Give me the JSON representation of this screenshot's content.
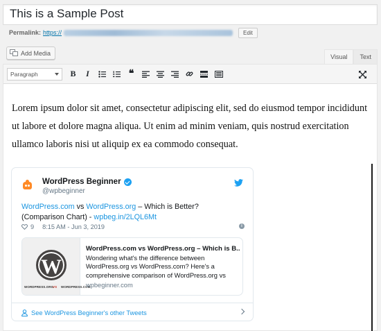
{
  "post": {
    "title": "This is a Sample Post",
    "permalink_label": "Permalink:",
    "permalink_url": "https://",
    "edit_label": "Edit"
  },
  "editor": {
    "add_media_label": "Add Media",
    "tabs": {
      "visual": "Visual",
      "text": "Text"
    },
    "toolbar": {
      "format_value": "Paragraph",
      "buttons": [
        "bold",
        "italic",
        "bulleted-list",
        "numbered-list",
        "blockquote",
        "align-left",
        "align-center",
        "align-right",
        "insert-link",
        "read-more",
        "toolbar-toggle",
        "distraction-free"
      ]
    },
    "content": {
      "paragraph": "Lorem ipsum dolor sit amet, consectetur adipiscing elit, sed do eiusmod tempor incididunt ut labore et dolore magna aliqua. Ut enim ad minim veniam, quis nostrud exercitation ullamco laboris nisi ut aliquip ex ea commodo consequat."
    }
  },
  "tweet": {
    "name": "WordPress Beginner",
    "handle": "@wpbeginner",
    "text_link1": "WordPress.com",
    "text_vs": " vs ",
    "text_link2": "WordPress.org",
    "text_rest": " – Which is Better? (Comparison Chart) - ",
    "text_link3": "wpbeg.in/2LQL6Mt",
    "likes": "9",
    "timestamp": "8:15 AM - Jun 3, 2019",
    "card": {
      "title": "WordPress.com vs WordPress.org – Which is B...",
      "description": "Wondering what's the difference between WordPress.org vs WordPress.com? Here's a comprehensive comparison of WordPress.org vs",
      "url": "wpbeginner.com",
      "img_label_left": "WORDPRESS.ORG",
      "img_label_vs": "VS",
      "img_label_right": "WORDPRESS.COM",
      "logo_letter": "W"
    },
    "footer_link": "See WordPress Beginner's other Tweets"
  },
  "colors": {
    "link": "#0073aa",
    "twitter_blue": "#1da1f2",
    "tweet_link": "#1b95e0"
  }
}
